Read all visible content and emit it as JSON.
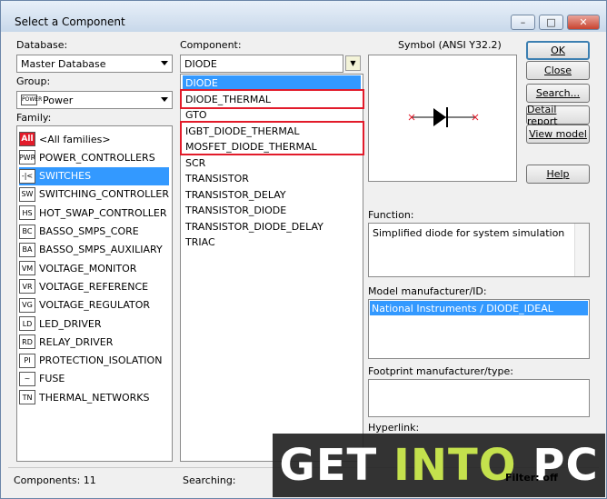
{
  "window": {
    "title": "Select a Component",
    "min_glyph": "–",
    "max_glyph": "□",
    "close_glyph": "✕"
  },
  "left": {
    "database_label": "Database:",
    "database_value": "Master Database",
    "group_label": "Group:",
    "group_value": "Power",
    "group_icon_text": "POWER",
    "family_label": "Family:",
    "families": [
      {
        "label": "<All families>",
        "icon": "All"
      },
      {
        "label": "POWER_CONTROLLERS",
        "icon": "PWR"
      },
      {
        "label": "SWITCHES",
        "icon": "-|<"
      },
      {
        "label": "SWITCHING_CONTROLLER",
        "icon": "SW"
      },
      {
        "label": "HOT_SWAP_CONTROLLER",
        "icon": "HS"
      },
      {
        "label": "BASSO_SMPS_CORE",
        "icon": "BC"
      },
      {
        "label": "BASSO_SMPS_AUXILIARY",
        "icon": "BA"
      },
      {
        "label": "VOLTAGE_MONITOR",
        "icon": "VM"
      },
      {
        "label": "VOLTAGE_REFERENCE",
        "icon": "VR"
      },
      {
        "label": "VOLTAGE_REGULATOR",
        "icon": "VG"
      },
      {
        "label": "LED_DRIVER",
        "icon": "LD"
      },
      {
        "label": "RELAY_DRIVER",
        "icon": "RD"
      },
      {
        "label": "PROTECTION_ISOLATION",
        "icon": "PI"
      },
      {
        "label": "FUSE",
        "icon": "~"
      },
      {
        "label": "THERMAL_NETWORKS",
        "icon": "TN"
      }
    ]
  },
  "middle": {
    "component_label": "Component:",
    "component_value": "DIODE",
    "filter_glyph": "▼",
    "components": [
      "DIODE",
      "DIODE_THERMAL",
      "GTO",
      "IGBT_DIODE_THERMAL",
      "MOSFET_DIODE_THERMAL",
      "SCR",
      "TRANSISTOR",
      "TRANSISTOR_DELAY",
      "TRANSISTOR_DIODE",
      "TRANSISTOR_DIODE_DELAY",
      "TRIAC"
    ]
  },
  "right": {
    "symbol_label": "Symbol (ANSI Y32.2)",
    "function_label": "Function:",
    "function_value": "Simplified diode for system simulation",
    "model_label": "Model manufacturer/ID:",
    "model_value": "National Instruments / DIODE_IDEAL",
    "footprint_label": "Footprint manufacturer/type:",
    "hyperlink_label": "Hyperlink:"
  },
  "buttons": {
    "ok": "OK",
    "close": "Close",
    "search": "Search...",
    "detail_report": "Detail report",
    "view_model": "View model",
    "help": "Help"
  },
  "status": {
    "components": "Components: 11",
    "searching": "Searching:",
    "filter": "Filter: off"
  },
  "watermark": {
    "part1": "GET ",
    "part2": "INTO",
    "part3": " PC"
  },
  "colors": {
    "selection": "#3399ff",
    "highlight_box": "#e21b2a",
    "watermark_accent": "#c4e14d"
  }
}
